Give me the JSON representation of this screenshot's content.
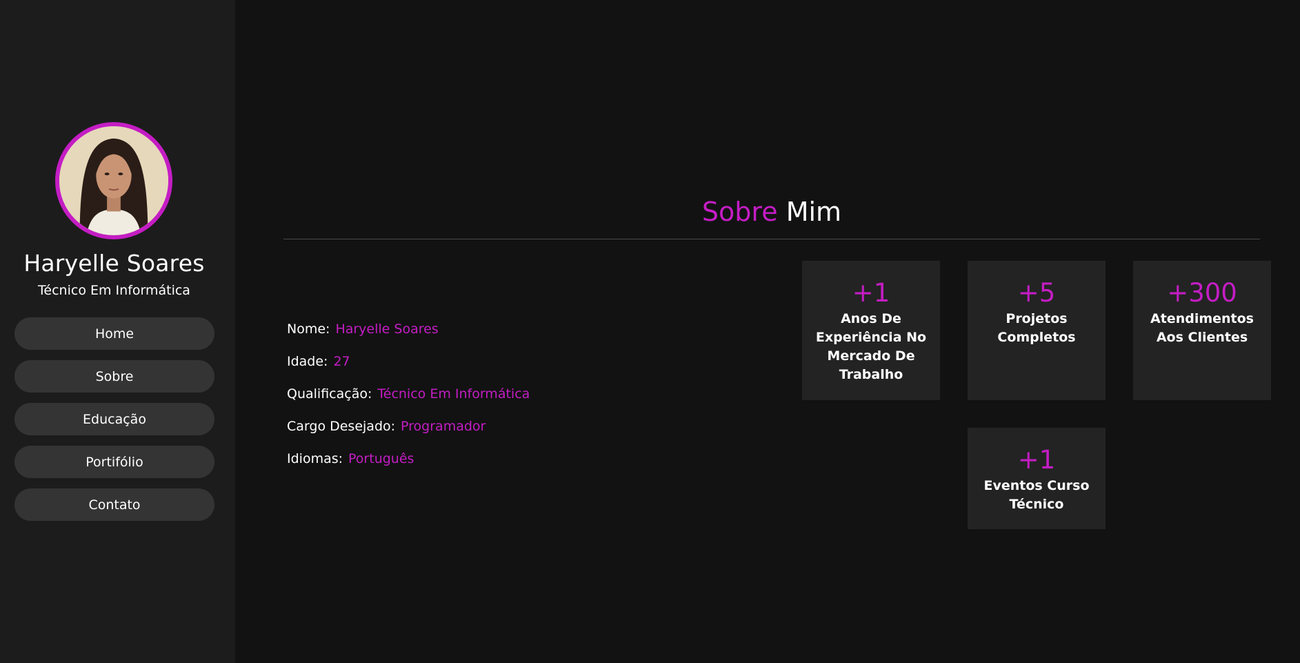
{
  "profile": {
    "name": "Haryelle Soares",
    "role": "Técnico Em Informática"
  },
  "nav": {
    "items": [
      {
        "label": "Home"
      },
      {
        "label": "Sobre"
      },
      {
        "label": "Educação"
      },
      {
        "label": "Portifólio"
      },
      {
        "label": "Contato"
      }
    ]
  },
  "section": {
    "title_accent": "Sobre",
    "title_rest": "Mim"
  },
  "info": [
    {
      "label": "Nome:",
      "value": "Haryelle Soares"
    },
    {
      "label": "Idade:",
      "value": "27"
    },
    {
      "label": "Qualificação:",
      "value": "Técnico Em Informática"
    },
    {
      "label": "Cargo Desejado:",
      "value": "Programador"
    },
    {
      "label": "Idiomas:",
      "value": "Português"
    }
  ],
  "stats": [
    {
      "number": "+1",
      "label": "Anos De Experiência No Mercado De Trabalho"
    },
    {
      "number": "+5",
      "label": "Projetos Completos"
    },
    {
      "number": "+300",
      "label": "Atendimentos Aos Clientes"
    },
    {
      "number": "+1",
      "label": "Eventos Curso Técnico"
    }
  ],
  "colors": {
    "accent": "#c41dc4",
    "background": "#121212",
    "sidebar": "#1c1c1c",
    "card": "#232323",
    "nav_button": "#343434"
  }
}
